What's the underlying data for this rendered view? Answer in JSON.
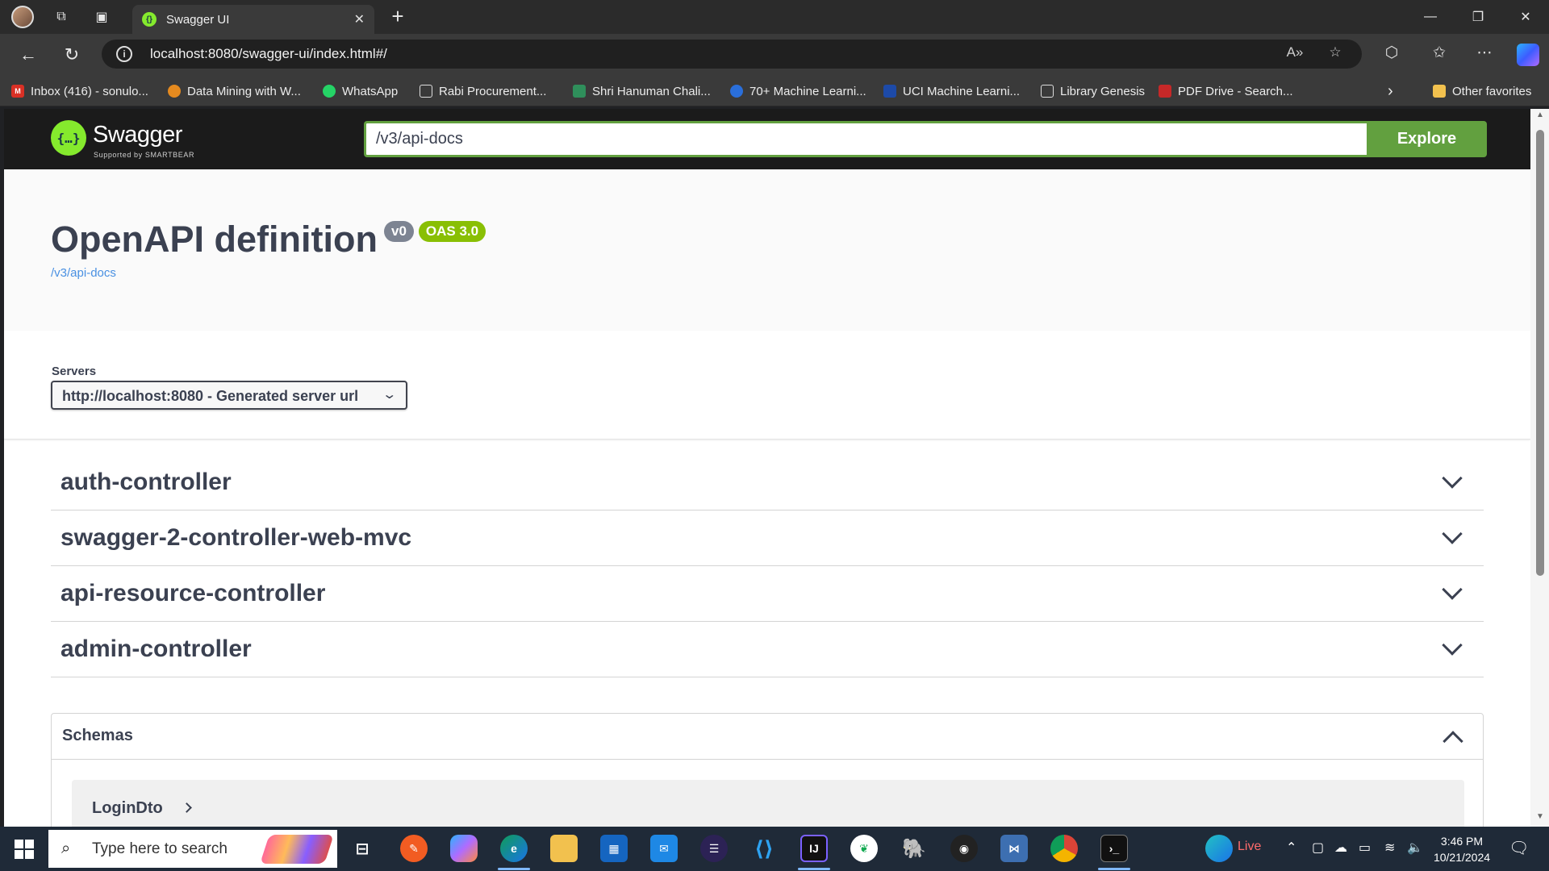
{
  "browser": {
    "tab_title": "Swagger UI",
    "tab_close": "✕",
    "new_tab": "+",
    "window_controls": {
      "minimize": "—",
      "restore": "❐",
      "close": "✕"
    },
    "url": "localhost:8080/swagger-ui/index.html#/",
    "bookmarks": [
      {
        "label": "Inbox (416) - sonulo...",
        "icon": "gmail-icon",
        "color": "#d93025"
      },
      {
        "label": "Data Mining with W...",
        "icon": "weka-icon",
        "color": "#e58a1f"
      },
      {
        "label": "WhatsApp",
        "icon": "whatsapp-icon",
        "color": "#25d366"
      },
      {
        "label": "Rabi Procurement...",
        "icon": "page-icon",
        "color": "#3a3a3a"
      },
      {
        "label": "Shri Hanuman Chali...",
        "icon": "bird-icon",
        "color": "#2f8f5b"
      },
      {
        "label": "70+ Machine Learni...",
        "icon": "ml-icon",
        "color": "#2a6fdb"
      },
      {
        "label": "UCI Machine Learni...",
        "icon": "uci-icon",
        "color": "#1d4aa8"
      },
      {
        "label": "Library Genesis",
        "icon": "page-icon",
        "color": "#3a3a3a"
      },
      {
        "label": "PDF Drive - Search...",
        "icon": "pdf-icon",
        "color": "#c62828"
      }
    ],
    "other_favorites": "Other favorites"
  },
  "swagger": {
    "brand": "Swagger",
    "brand_sub": "Supported by SMARTBEAR",
    "search_value": "/v3/api-docs",
    "explore_label": "Explore",
    "title": "OpenAPI definition",
    "version_badge": "v0",
    "oas_badge": "OAS 3.0",
    "spec_link": "/v3/api-docs",
    "servers_label": "Servers",
    "server_selected": "http://localhost:8080 - Generated server url",
    "tags": [
      "auth-controller",
      "swagger-2-controller-web-mvc",
      "api-resource-controller",
      "admin-controller"
    ],
    "schemas_title": "Schemas",
    "schemas": [
      "LoginDto"
    ]
  },
  "taskbar": {
    "search_placeholder": "Type here to search",
    "live_label": "Live",
    "time": "3:46 PM",
    "date": "10/21/2024"
  },
  "colors": {
    "swagger_green": "#62a03f",
    "oas_badge": "#89bf04",
    "version_badge": "#7d8492",
    "text_primary": "#3b4151",
    "link": "#4990e2"
  }
}
